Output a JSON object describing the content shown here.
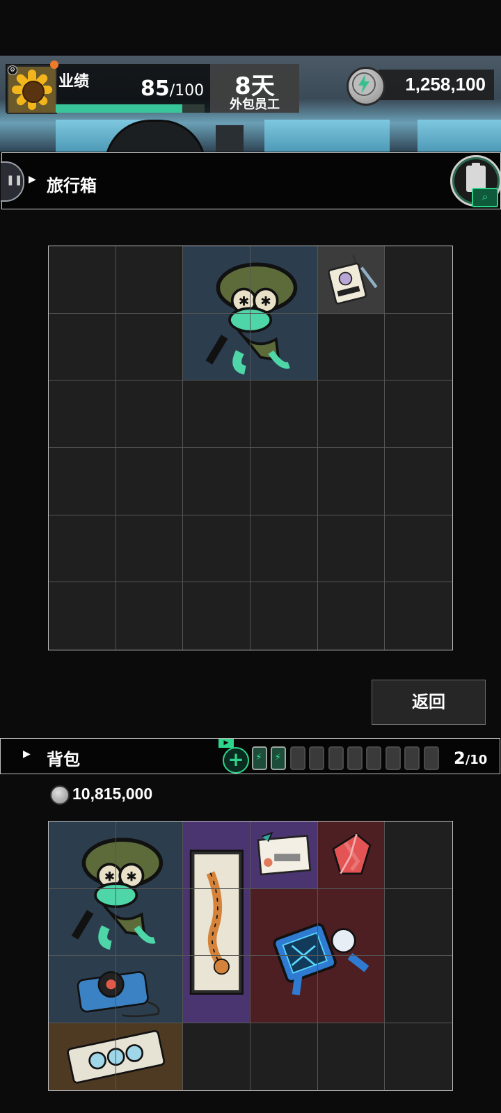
{
  "header": {
    "performance_label": "业绩",
    "performance_value": "85",
    "performance_max": "/100",
    "performance_fraction": 0.85,
    "day_value": "8天",
    "day_subtitle": "外包员工",
    "currency_value": "1,258,100"
  },
  "suitcase": {
    "title": "旅行箱",
    "grid": {
      "cols": 6,
      "rows": 6
    },
    "items": [
      {
        "name": "frog-character",
        "col": 2,
        "row": 0,
        "w": 2,
        "h": 2,
        "color": "#2c3e4e"
      },
      {
        "name": "work-badge",
        "col": 4,
        "row": 0,
        "w": 1,
        "h": 1,
        "color": "#3c3c3c",
        "label": "工作证"
      }
    ],
    "back_label": "返回"
  },
  "backpack": {
    "title": "背包",
    "video_tag": "▶",
    "add_label": "+",
    "batteries_total": 10,
    "batteries_full": 2,
    "count_value": "2",
    "count_max": "/10",
    "currency_value": "10,815,000",
    "grid": {
      "cols": 6,
      "rows": 4
    },
    "items": [
      {
        "name": "frog-character",
        "col": 0,
        "row": 0,
        "w": 2,
        "h": 2,
        "color": "#2c3e4e"
      },
      {
        "name": "cd-player",
        "col": 0,
        "row": 2,
        "w": 2,
        "h": 1,
        "color": "#2c3e4e"
      },
      {
        "name": "cassette-tape",
        "col": 0,
        "row": 3,
        "w": 2,
        "h": 1,
        "color": "#4e3a22"
      },
      {
        "name": "tiger-scroll",
        "col": 2,
        "row": 0,
        "w": 1,
        "h": 3,
        "color": "#4a3570"
      },
      {
        "name": "postcard",
        "col": 3,
        "row": 0,
        "w": 1,
        "h": 1,
        "color": "#4a3570"
      },
      {
        "name": "red-crystal",
        "col": 4,
        "row": 0,
        "w": 1,
        "h": 1,
        "color": "#4d1e22"
      },
      {
        "name": "robot-monitor",
        "col": 3,
        "row": 1,
        "w": 2,
        "h": 2,
        "color": "#4d1e22"
      }
    ]
  }
}
